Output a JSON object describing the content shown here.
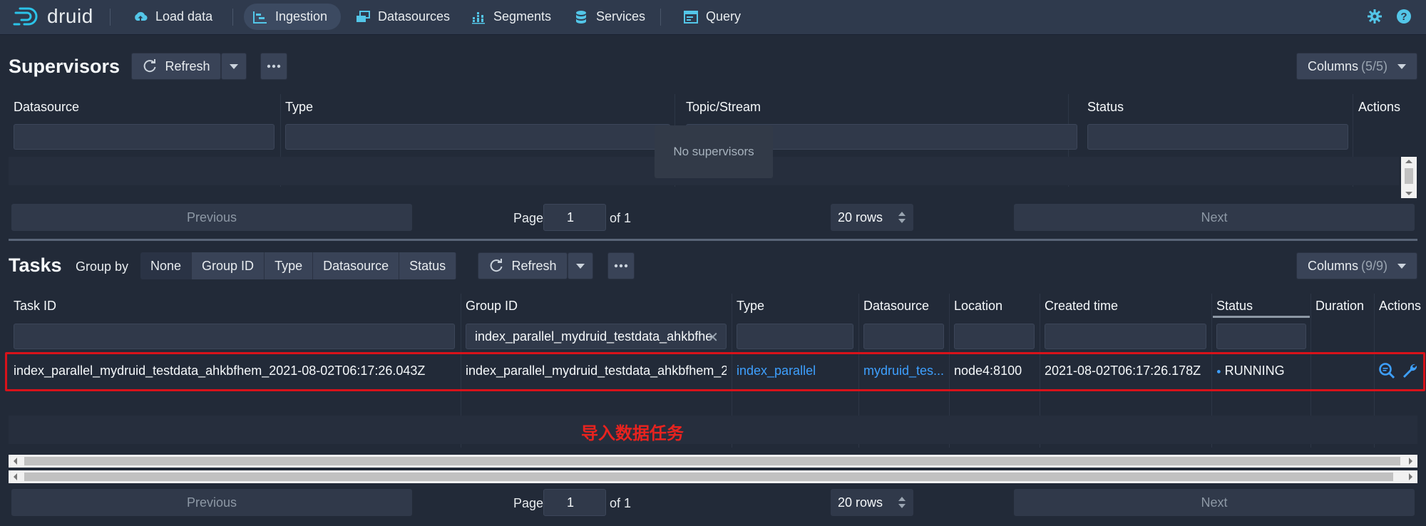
{
  "nav": {
    "brand": "druid",
    "load_data": "Load data",
    "ingestion": "Ingestion",
    "datasources": "Datasources",
    "segments": "Segments",
    "services": "Services",
    "query": "Query",
    "accent_color": "#53c6e8"
  },
  "supervisors": {
    "title": "Supervisors",
    "refresh": "Refresh",
    "columns_label": "Columns",
    "columns_count": "(5/5)",
    "headers": [
      "Datasource",
      "Type",
      "Topic/Stream",
      "Status",
      "Actions"
    ],
    "empty_text": "No supervisors",
    "pagination": {
      "previous": "Previous",
      "page": "Page",
      "page_value": "1",
      "of": "of 1",
      "rows": "20 rows",
      "next": "Next"
    }
  },
  "tasks": {
    "title": "Tasks",
    "group_by_label": "Group by",
    "group_by_options": [
      "None",
      "Group ID",
      "Type",
      "Datasource",
      "Status"
    ],
    "group_by_selected": "None",
    "refresh": "Refresh",
    "columns_label": "Columns",
    "columns_count": "(9/9)",
    "headers": [
      "Task ID",
      "Group ID",
      "Type",
      "Datasource",
      "Location",
      "Created time",
      "Status",
      "Duration",
      "Actions"
    ],
    "group_id_filter_value": "index_parallel_mydruid_testdata_ahkbfhe",
    "rows": [
      {
        "task_id": "index_parallel_mydruid_testdata_ahkbfhem_2021-08-02T06:17:26.043Z",
        "group_id": "index_parallel_mydruid_testdata_ahkbfhem_2...",
        "type": "index_parallel",
        "datasource": "mydruid_tes...",
        "location": "node4:8100",
        "created_time": "2021-08-02T06:17:26.178Z",
        "status": "RUNNING",
        "status_dot": "●"
      }
    ],
    "annotation": "导入数据任务",
    "annotation_color": "#e8231f",
    "link_color": "#3ea0ff",
    "pagination": {
      "previous": "Previous",
      "page": "Page",
      "page_value": "1",
      "of": "of 1",
      "rows": "20 rows",
      "next": "Next"
    }
  }
}
